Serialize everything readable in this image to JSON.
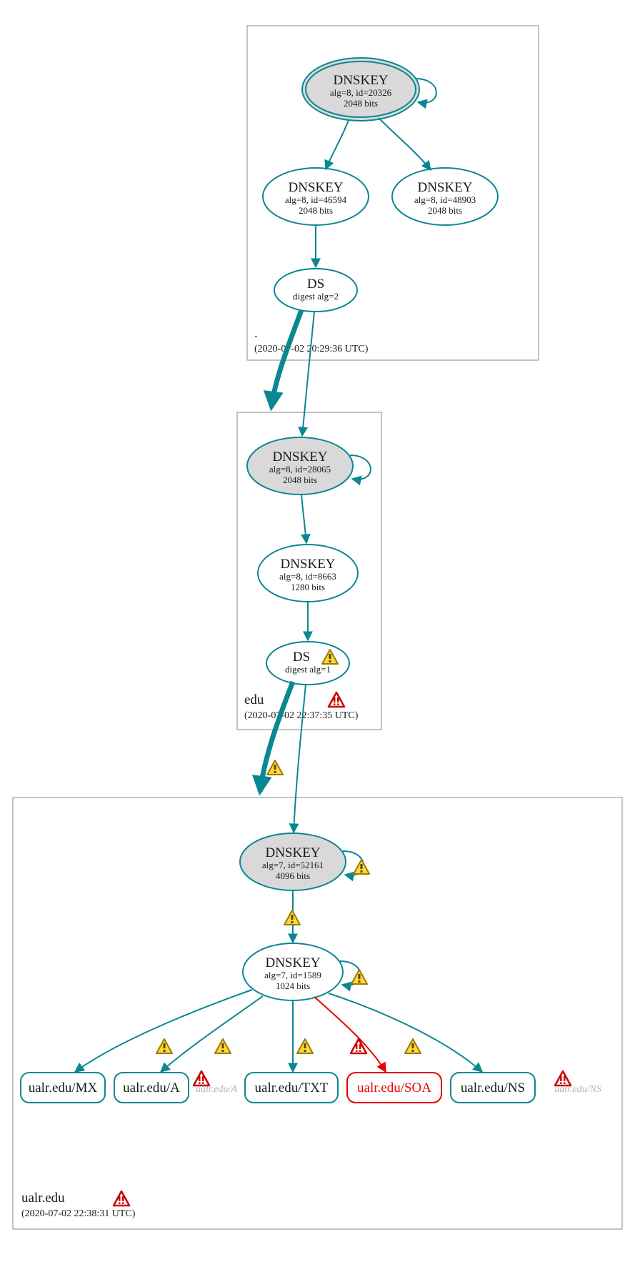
{
  "zones": {
    "root": {
      "label": ".",
      "timestamp": "(2020-07-02 20:29:36 UTC)"
    },
    "edu": {
      "label": "edu",
      "timestamp": "(2020-07-02 22:37:35 UTC)"
    },
    "ualr": {
      "label": "ualr.edu",
      "timestamp": "(2020-07-02 22:38:31 UTC)"
    }
  },
  "nodes": {
    "root_ksk": {
      "title": "DNSKEY",
      "line2": "alg=8, id=20326",
      "line3": "2048 bits"
    },
    "root_zsk1": {
      "title": "DNSKEY",
      "line2": "alg=8, id=46594",
      "line3": "2048 bits"
    },
    "root_zsk2": {
      "title": "DNSKEY",
      "line2": "alg=8, id=48903",
      "line3": "2048 bits"
    },
    "root_ds": {
      "title": "DS",
      "line2": "digest alg=2"
    },
    "edu_ksk": {
      "title": "DNSKEY",
      "line2": "alg=8, id=28065",
      "line3": "2048 bits"
    },
    "edu_zsk": {
      "title": "DNSKEY",
      "line2": "alg=8, id=8663",
      "line3": "1280 bits"
    },
    "edu_ds": {
      "title": "DS",
      "line2": "digest alg=1"
    },
    "ualr_ksk": {
      "title": "DNSKEY",
      "line2": "alg=7, id=52161",
      "line3": "4096 bits"
    },
    "ualr_zsk": {
      "title": "DNSKEY",
      "line2": "alg=7, id=1589",
      "line3": "1024 bits"
    }
  },
  "rrsets": {
    "mx": "ualr.edu/MX",
    "a": "ualr.edu/A",
    "txt": "ualr.edu/TXT",
    "soa": "ualr.edu/SOA",
    "ns": "ualr.edu/NS"
  },
  "ghosts": {
    "a": "ualr.edu/A",
    "ns": "ualr.edu/NS"
  },
  "colors": {
    "teal": "#0b8793",
    "red": "#e60000",
    "warn_fill": "#ffd83a",
    "warn_stroke": "#9a7b00",
    "err_fill": "#ffffff",
    "err_stroke": "#cc0000"
  }
}
